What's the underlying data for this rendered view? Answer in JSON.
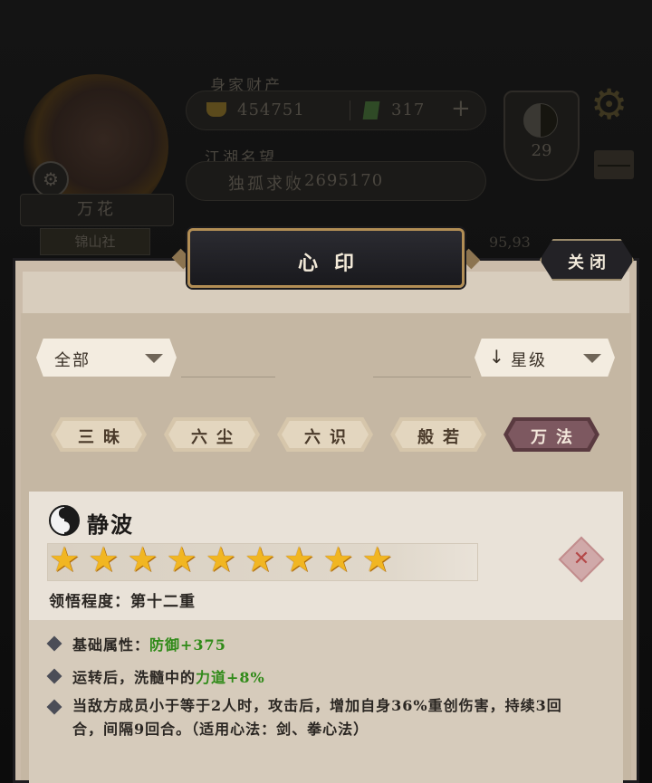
{
  "header": {
    "wealth_label": "身家财产",
    "silver": "454751",
    "jade": "317",
    "fame_label": "江湖名望",
    "fame_title": "独孤求败",
    "fame_value": "2695170",
    "player_name": "万花",
    "sect": "锦山社",
    "level_badge": "29",
    "partial_number": "95,93"
  },
  "dialog": {
    "title": "心印",
    "close_label": "关闭",
    "filter_all": "全部",
    "sort_arrow": "↓",
    "sort_label": "星级",
    "tabs": [
      "三昧",
      "六尘",
      "六识",
      "般若",
      "万法"
    ],
    "active_tab": "万法"
  },
  "skill": {
    "name": "静波",
    "stars": 9,
    "comprehension_label": "领悟程度：",
    "comprehension_value": "第十二重",
    "attr1_label": "基础属性：",
    "attr1_value": "防御+375",
    "attr2_label": "运转后，洗髓中的",
    "attr2_value": "力道+8%",
    "attr3_text": "当敌方成员小于等于2人时，攻击后，增加自身36%重创伤害，持续3回合，间隔9回合。（适用心法：剑、拳心法）"
  },
  "colors": {
    "accent_gold": "#b28e55",
    "active_tab": "#7d5860",
    "positive_green": "#2f8a18",
    "star": "#f1b622"
  }
}
